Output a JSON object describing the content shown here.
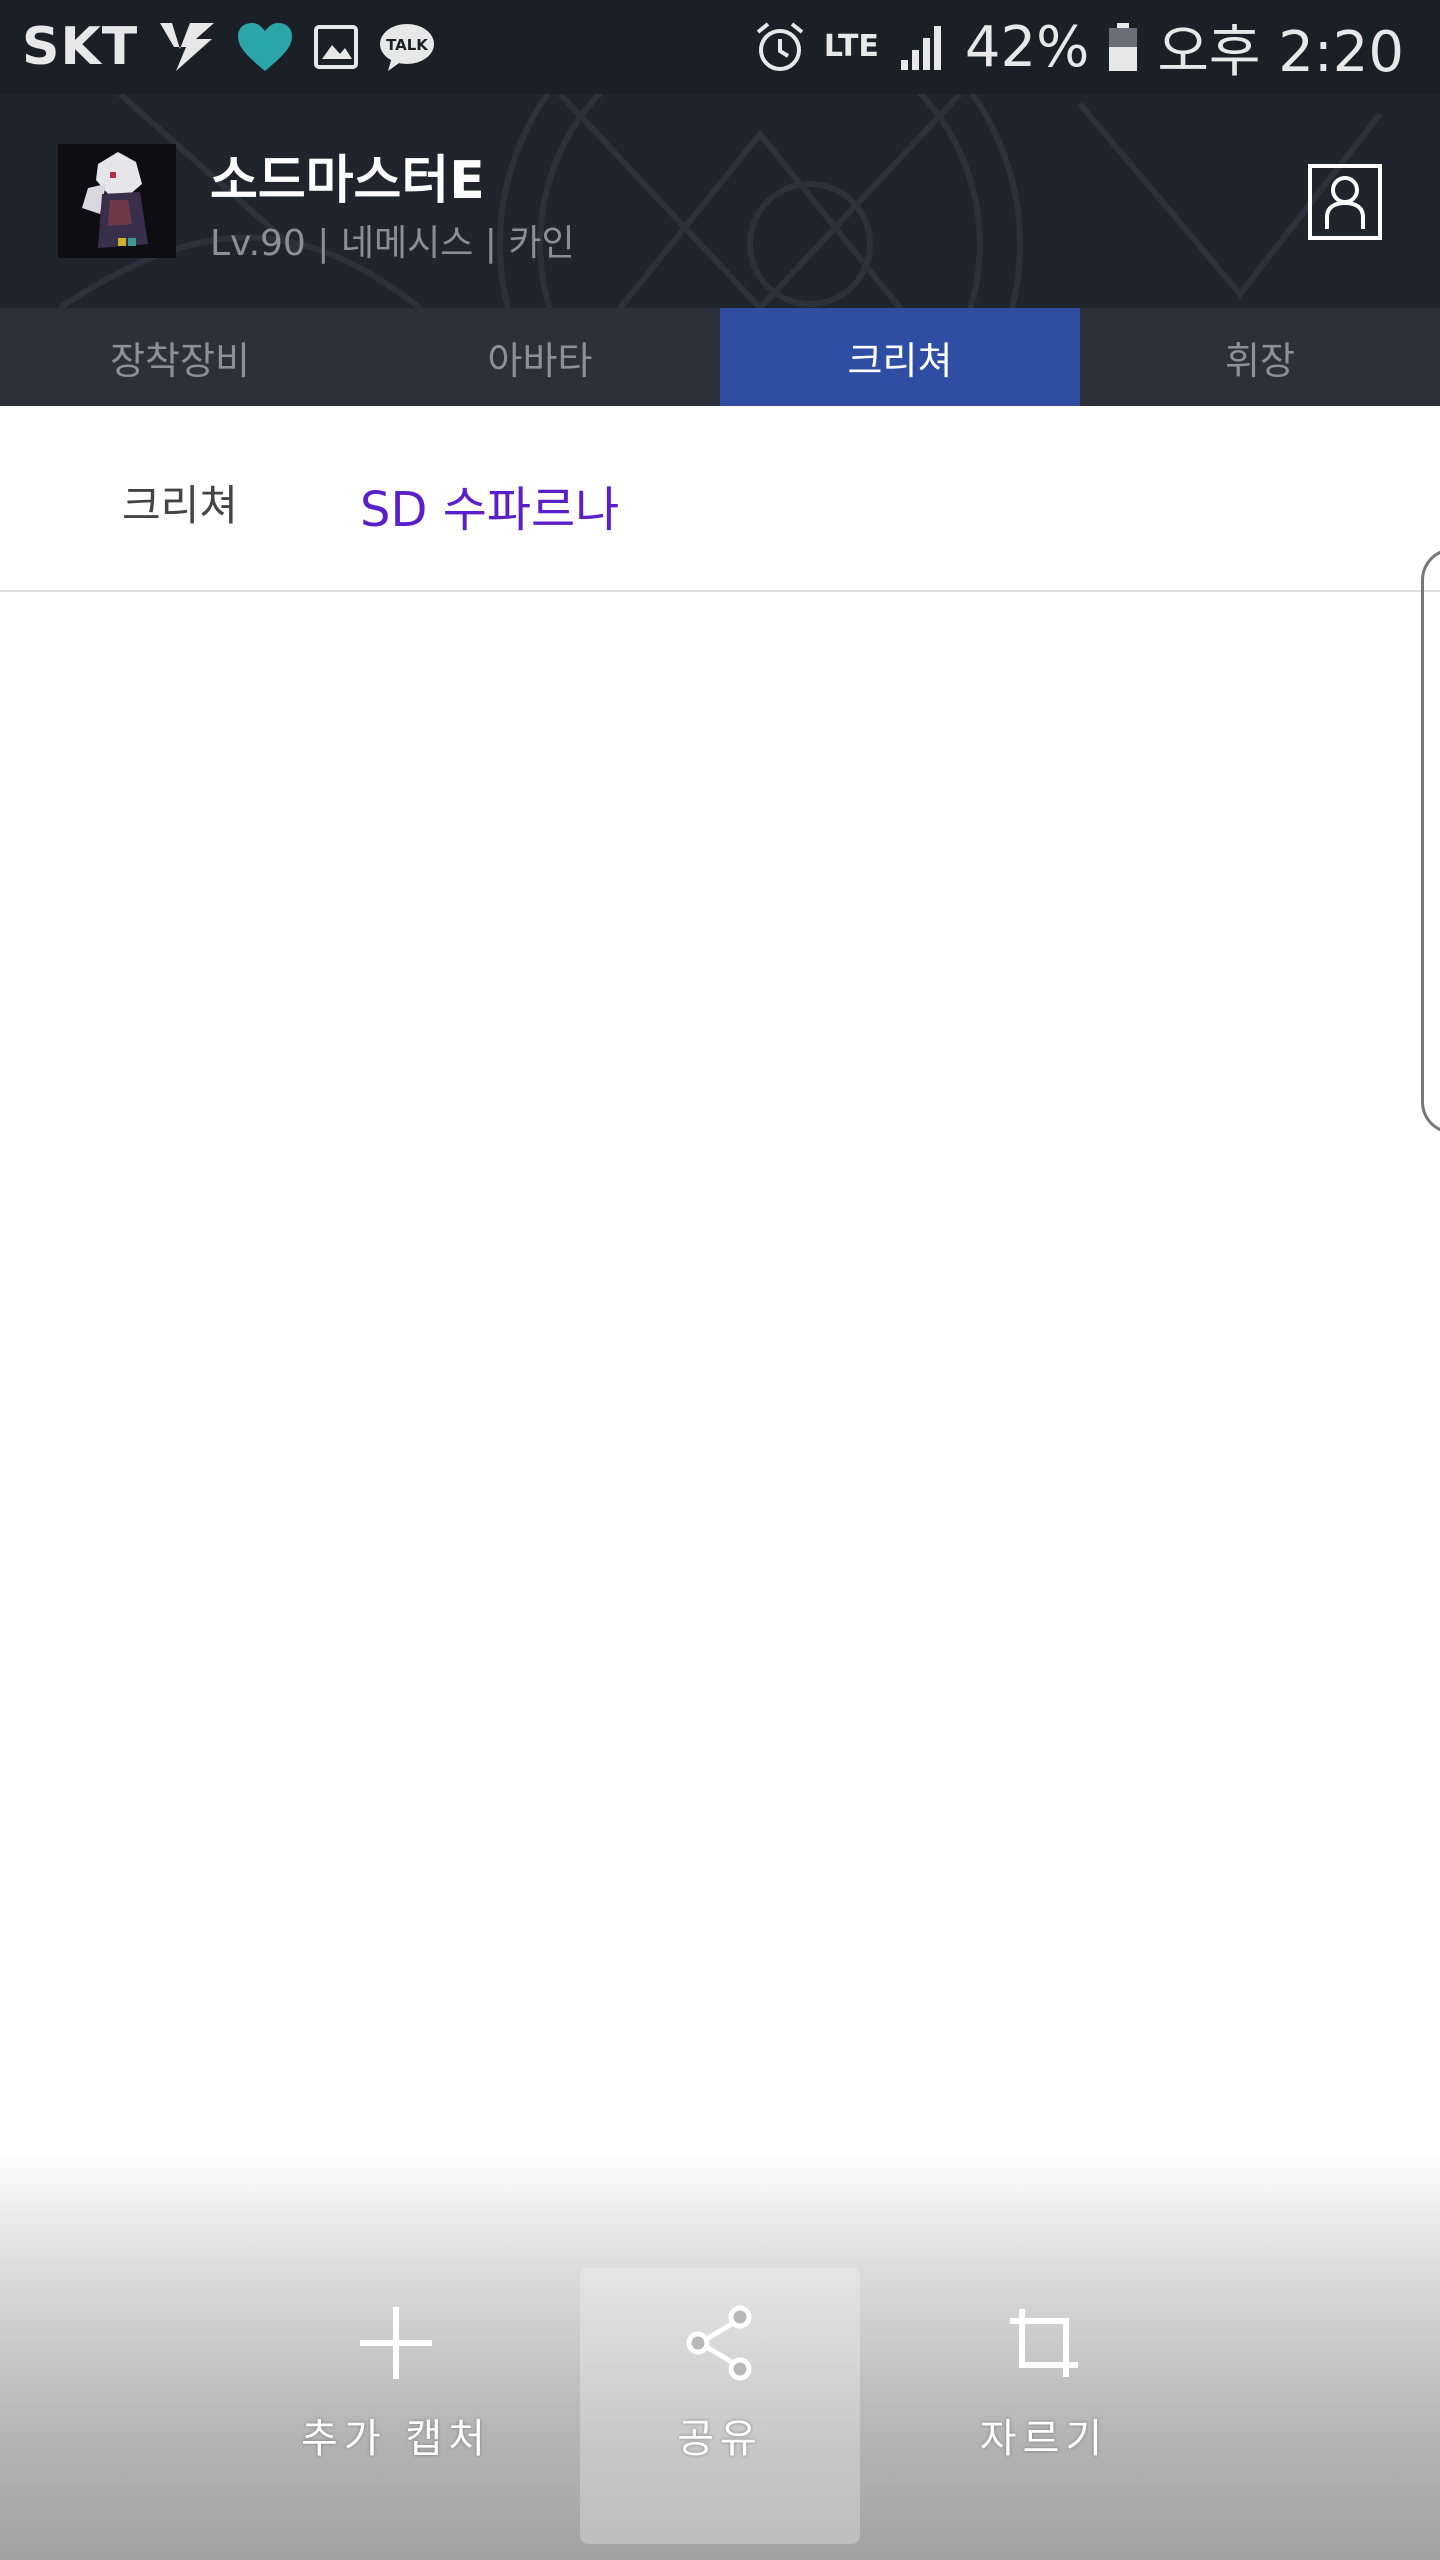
{
  "status_bar": {
    "carrier": "SKT",
    "network": "LTE",
    "battery_percent": "42%",
    "time": "오후 2:20",
    "icons": [
      "carrier-logo-icon",
      "heart-icon",
      "gallery-icon",
      "kakaotalk-icon",
      "alarm-icon",
      "lte-data-icon",
      "signal-icon",
      "battery-icon"
    ],
    "accent_color": "#2aa6a8"
  },
  "profile": {
    "name": "소드마스터E",
    "meta": "Lv.90 | 네메시스 | 카인"
  },
  "main_tabs": [
    {
      "label": "장착장비",
      "active": false
    },
    {
      "label": "아바타",
      "active": false
    },
    {
      "label": "크리쳐",
      "active": true
    },
    {
      "label": "휘장",
      "active": false
    }
  ],
  "creature": {
    "label": "크리쳐",
    "value": "SD 수파르나"
  },
  "capture_toolbar": {
    "items": [
      {
        "label": "추가 캡처",
        "icon": "plus-icon"
      },
      {
        "label": "공유",
        "icon": "share-icon",
        "pressed": true
      },
      {
        "label": "자르기",
        "icon": "crop-icon"
      }
    ]
  },
  "colors": {
    "active_tab": "#2f4ea3",
    "creature_value": "#5b1fc9",
    "header_bg": "#20242d"
  }
}
